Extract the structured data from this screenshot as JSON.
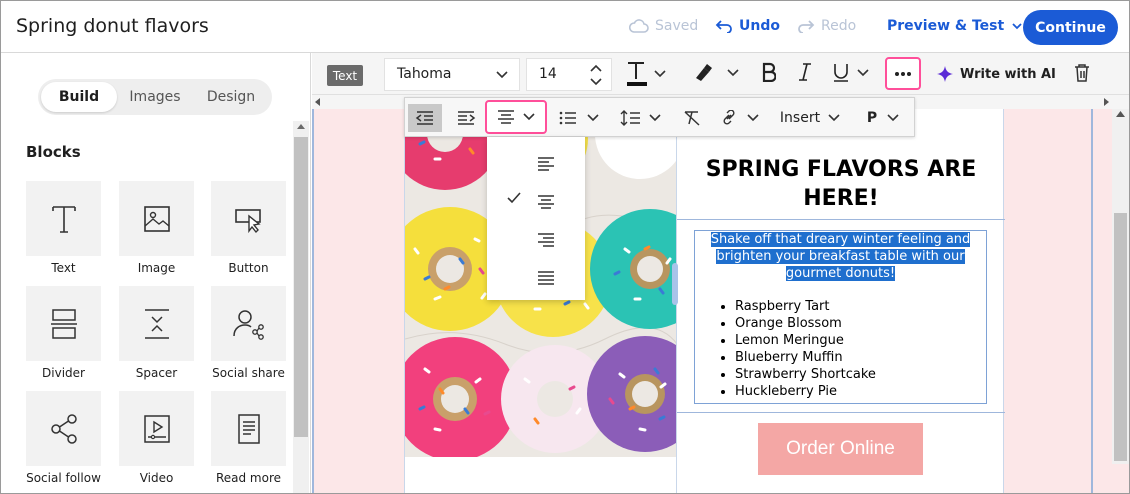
{
  "header": {
    "title": "Spring donut flavors",
    "saved_label": "Saved",
    "undo_label": "Undo",
    "redo_label": "Redo",
    "preview_label": "Preview & Test",
    "continue_label": "Continue"
  },
  "left_panel": {
    "tabs": [
      {
        "label": "Build",
        "active": true
      },
      {
        "label": "Images",
        "active": false
      },
      {
        "label": "Design",
        "active": false
      }
    ],
    "blocks_title": "Blocks",
    "blocks": [
      {
        "label": "Text",
        "icon": "text-icon"
      },
      {
        "label": "Image",
        "icon": "image-icon"
      },
      {
        "label": "Button",
        "icon": "button-icon"
      },
      {
        "label": "Divider",
        "icon": "divider-icon"
      },
      {
        "label": "Spacer",
        "icon": "spacer-icon"
      },
      {
        "label": "Social share",
        "icon": "social-share-icon"
      },
      {
        "label": "Social follow",
        "icon": "social-follow-icon"
      },
      {
        "label": "Video",
        "icon": "video-icon"
      },
      {
        "label": "Read more",
        "icon": "read-more-icon"
      }
    ]
  },
  "toolbar": {
    "tag": "Text",
    "font": "Tahoma",
    "size": "14",
    "write_ai": "Write with AI",
    "insert_label": "Insert",
    "paragraph_label": "P"
  },
  "email": {
    "headline": "SPRING FLAVORS ARE HERE!",
    "intro": "Shake off that dreary winter feeling and brighten your breakfast table with our gourmet donuts!",
    "flavors": [
      "Raspberry Tart",
      "Orange Blossom",
      "Lemon Meringue",
      "Blueberry Muffin",
      "Strawberry Shortcake",
      "Huckleberry Pie"
    ],
    "cta": "Order Online"
  },
  "align_menu": {
    "options": [
      "left",
      "center",
      "right",
      "justify"
    ],
    "selected": "center"
  },
  "colors": {
    "accent": "#1b5bd6",
    "highlight_border": "#ff4f9a",
    "canvas_bg": "#fce7e8",
    "cta_bg": "#f4a7a5"
  }
}
